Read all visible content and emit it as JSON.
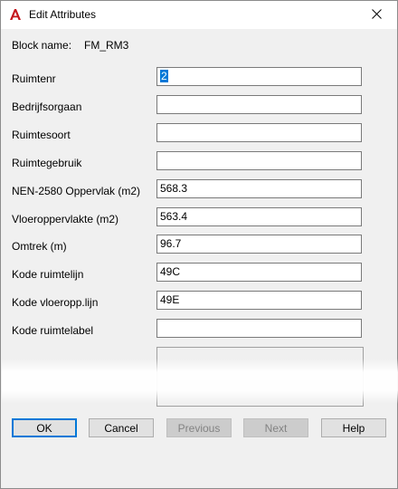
{
  "window": {
    "title": "Edit Attributes",
    "app_icon": "autocad-a-icon",
    "close_icon": "close-icon"
  },
  "block": {
    "label": "Block name:",
    "value": "FM_RM3"
  },
  "attributes": [
    {
      "label": "Ruimtenr",
      "value": "2",
      "selected": true
    },
    {
      "label": "Bedrijfsorgaan",
      "value": ""
    },
    {
      "label": "Ruimtesoort",
      "value": ""
    },
    {
      "label": "Ruimtegebruik",
      "value": ""
    },
    {
      "label": "NEN-2580 Oppervlak (m2)",
      "value": "568.3"
    },
    {
      "label": "Vloeroppervlakte (m2)",
      "value": "563.4"
    },
    {
      "label": "Omtrek (m)",
      "value": "96.7"
    },
    {
      "label": "Kode ruimtelijn",
      "value": "49C"
    },
    {
      "label": "Kode vloeropp.lijn",
      "value": "49E"
    },
    {
      "label": "Kode ruimtelabel",
      "value": ""
    }
  ],
  "buttons": {
    "ok": "OK",
    "cancel": "Cancel",
    "previous": "Previous",
    "next": "Next",
    "help": "Help"
  },
  "colors": {
    "selection": "#0078d7",
    "dialog_bg": "#f0f0f0",
    "brand_red": "#c4161c"
  }
}
